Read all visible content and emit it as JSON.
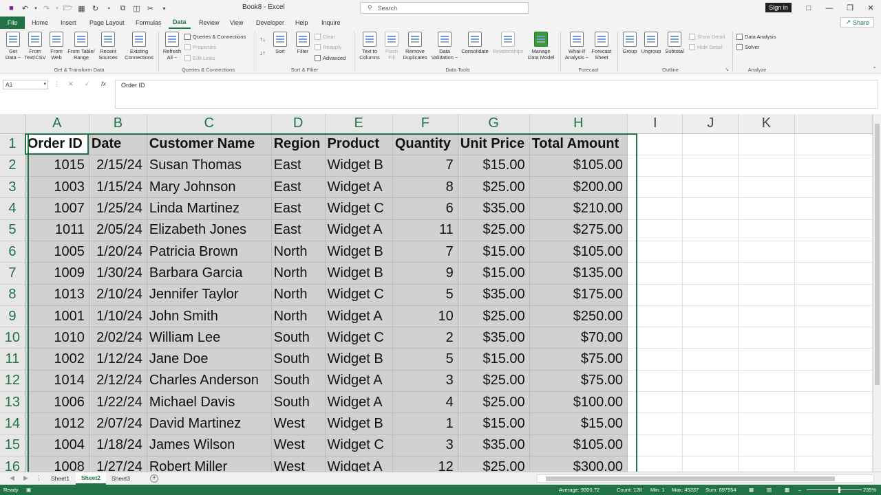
{
  "window": {
    "title": "Book8 - Excel",
    "search_placeholder": "Search",
    "signin": "Sign in",
    "share": "Share"
  },
  "menu_tabs": [
    "File",
    "Home",
    "Insert",
    "Page Layout",
    "Formulas",
    "Data",
    "Review",
    "View",
    "Developer",
    "Help",
    "Inquire"
  ],
  "active_tab": "Data",
  "ribbon": {
    "get_data": [
      "Get",
      "Data ~"
    ],
    "from_text": [
      "From",
      "Text/CSV"
    ],
    "from_web": [
      "From",
      "Web"
    ],
    "from_table": [
      "From Table/",
      "Range"
    ],
    "recent_sources": [
      "Recent",
      "Sources"
    ],
    "existing_connections": [
      "Existing",
      "Connections"
    ],
    "refresh_all": [
      "Refresh",
      "All ~"
    ],
    "queries_connections": "Queries & Connections",
    "properties": "Properties",
    "edit_links": "Edit Links",
    "sort": "Sort",
    "filter": "Filter",
    "clear": "Clear",
    "reapply": "Reapply",
    "advanced": "Advanced",
    "text_to_columns": [
      "Text to",
      "Columns"
    ],
    "flash_fill": [
      "Flash",
      "Fill"
    ],
    "remove_duplicates": [
      "Remove",
      "Duplicates"
    ],
    "data_validation": [
      "Data",
      "Validation ~"
    ],
    "consolidate": "Consolidate",
    "relationships": "Relationships",
    "manage_data_model": [
      "Manage",
      "Data Model"
    ],
    "what_if": [
      "What-If",
      "Analysis ~"
    ],
    "forecast_sheet": [
      "Forecast",
      "Sheet"
    ],
    "group": "Group",
    "ungroup": "Ungroup",
    "subtotal": "Subtotal",
    "show_detail": "Show Detail",
    "hide_detail": "Hide Detail",
    "data_analysis": "Data Analysis",
    "solver": "Solver",
    "groups": {
      "get_transform": "Get & Transform Data",
      "queries": "Queries & Connections",
      "sort_filter": "Sort & Filter",
      "data_tools": "Data Tools",
      "forecast": "Forecast",
      "outline": "Outline",
      "analyze": "Analyze"
    }
  },
  "name_box": "A1",
  "formula_value": "Order ID",
  "columns": [
    "A",
    "B",
    "C",
    "D",
    "E",
    "F",
    "G",
    "H",
    "I",
    "J",
    "K"
  ],
  "header_row": [
    "Order ID",
    "Date",
    "Customer Name",
    "Region",
    "Product",
    "Quantity",
    "Unit Price",
    "Total Amount"
  ],
  "rows": [
    [
      "1015",
      "2/15/24",
      "Susan Thomas",
      "East",
      "Widget B",
      "7",
      "$15.00",
      "$105.00"
    ],
    [
      "1003",
      "1/15/24",
      "Mary Johnson",
      "East",
      "Widget A",
      "8",
      "$25.00",
      "$200.00"
    ],
    [
      "1007",
      "1/25/24",
      "Linda Martinez",
      "East",
      "Widget C",
      "6",
      "$35.00",
      "$210.00"
    ],
    [
      "1011",
      "2/05/24",
      "Elizabeth Jones",
      "East",
      "Widget A",
      "11",
      "$25.00",
      "$275.00"
    ],
    [
      "1005",
      "1/20/24",
      "Patricia Brown",
      "North",
      "Widget B",
      "7",
      "$15.00",
      "$105.00"
    ],
    [
      "1009",
      "1/30/24",
      "Barbara Garcia",
      "North",
      "Widget B",
      "9",
      "$15.00",
      "$135.00"
    ],
    [
      "1013",
      "2/10/24",
      "Jennifer Taylor",
      "North",
      "Widget C",
      "5",
      "$35.00",
      "$175.00"
    ],
    [
      "1001",
      "1/10/24",
      "John Smith",
      "North",
      "Widget A",
      "10",
      "$25.00",
      "$250.00"
    ],
    [
      "1010",
      "2/02/24",
      "William Lee",
      "South",
      "Widget C",
      "2",
      "$35.00",
      "$70.00"
    ],
    [
      "1002",
      "1/12/24",
      "Jane Doe",
      "South",
      "Widget B",
      "5",
      "$15.00",
      "$75.00"
    ],
    [
      "1014",
      "2/12/24",
      "Charles Anderson",
      "South",
      "Widget A",
      "3",
      "$25.00",
      "$75.00"
    ],
    [
      "1006",
      "1/22/24",
      "Michael Davis",
      "South",
      "Widget A",
      "4",
      "$25.00",
      "$100.00"
    ],
    [
      "1012",
      "2/07/24",
      "David Martinez",
      "West",
      "Widget B",
      "1",
      "$15.00",
      "$15.00"
    ],
    [
      "1004",
      "1/18/24",
      "James Wilson",
      "West",
      "Widget C",
      "3",
      "$35.00",
      "$105.00"
    ],
    [
      "1008",
      "1/27/24",
      "Robert Miller",
      "West",
      "Widget A",
      "12",
      "$25.00",
      "$300.00"
    ]
  ],
  "sheet_tabs": [
    "Sheet1",
    "Sheet2",
    "Sheet3"
  ],
  "active_sheet": "Sheet2",
  "status": {
    "ready": "Ready",
    "average": "Average: 9300.72",
    "count": "Count: 128",
    "min": "Min: 1",
    "max": "Max: 45337",
    "sum": "Sum: 697554",
    "zoom": "235%"
  },
  "colors": {
    "accent": "#217346",
    "selection": "#d1d1d1"
  }
}
